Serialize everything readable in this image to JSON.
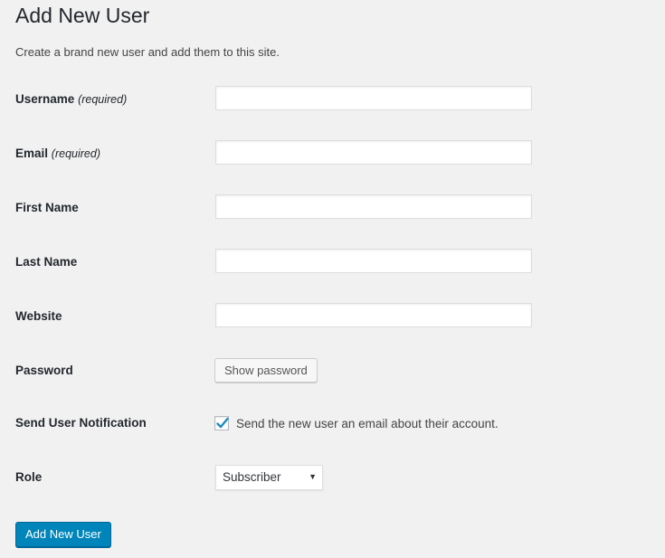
{
  "page": {
    "title": "Add New User",
    "description": "Create a brand new user and add them to this site."
  },
  "form": {
    "fields": [
      {
        "label": "Username",
        "note": "(required)",
        "value": ""
      },
      {
        "label": "Email",
        "note": "(required)",
        "value": ""
      },
      {
        "label": "First Name",
        "note": "",
        "value": ""
      },
      {
        "label": "Last Name",
        "note": "",
        "value": ""
      },
      {
        "label": "Website",
        "note": "",
        "value": ""
      }
    ],
    "password": {
      "label": "Password",
      "button_label": "Show password"
    },
    "notification": {
      "label": "Send User Notification",
      "checkbox_label": "Send the new user an email about their account.",
      "checked": true
    },
    "role": {
      "label": "Role",
      "selected": "Subscriber",
      "arrow": "▼"
    },
    "submit_label": "Add New User"
  },
  "colors": {
    "primary": "#0085ba",
    "check": "#1e8cbe",
    "background": "#f1f1f1"
  }
}
